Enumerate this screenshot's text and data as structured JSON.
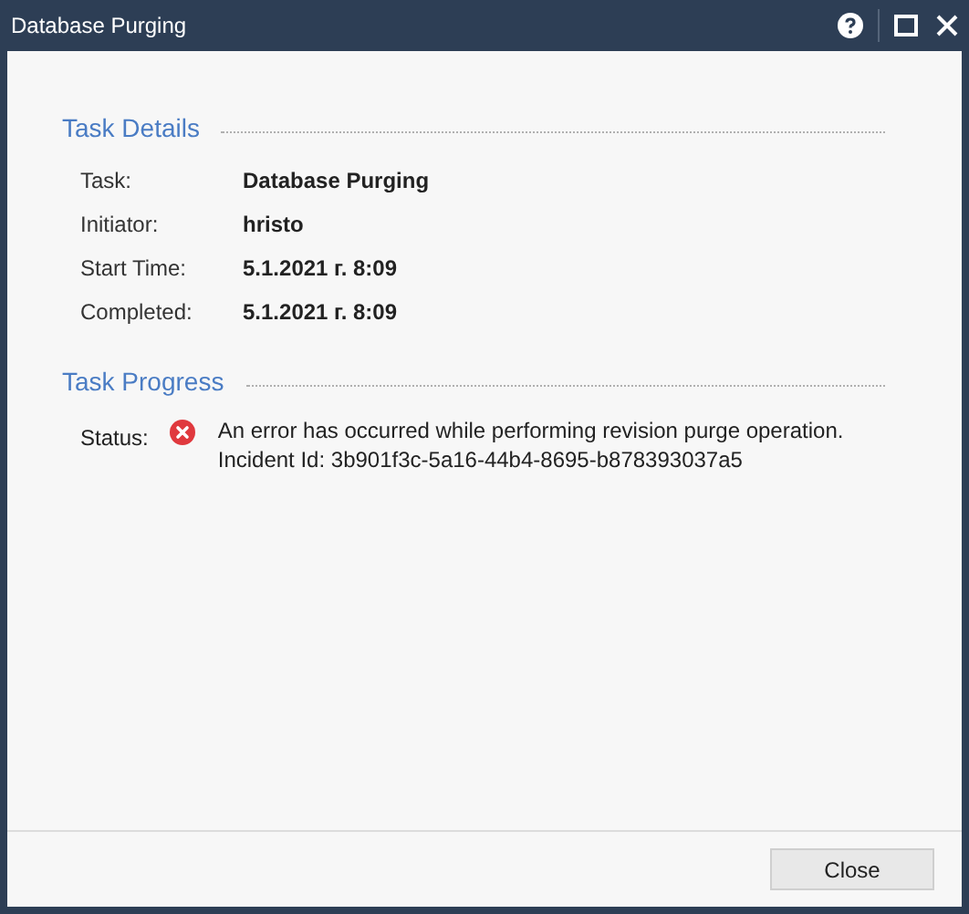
{
  "window": {
    "title": "Database Purging"
  },
  "task_details": {
    "heading": "Task Details",
    "rows": [
      {
        "label": "Task:",
        "value": "Database Purging"
      },
      {
        "label": "Initiator:",
        "value": "hristo"
      },
      {
        "label": "Start Time:",
        "value": "5.1.2021 г. 8:09"
      },
      {
        "label": "Completed:",
        "value": "5.1.2021 г. 8:09"
      }
    ]
  },
  "task_progress": {
    "heading": "Task Progress",
    "status_label": "Status:",
    "kind": "error",
    "message_lines": [
      "An error has occurred while performing revision purge operation.",
      "Incident Id: 3b901f3c-5a16-44b4-8695-b878393037a5"
    ]
  },
  "buttons": [
    "Close"
  ]
}
